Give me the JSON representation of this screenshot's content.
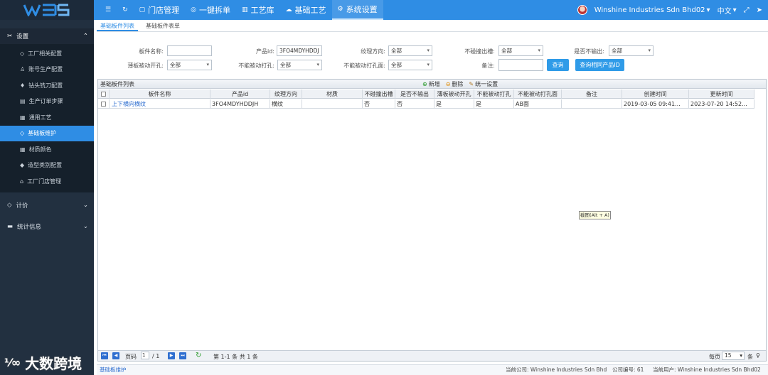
{
  "app": {
    "brand_color": "#2f8de4",
    "sidebar_color": "#223040"
  },
  "topnav": {
    "items": [
      {
        "icon": "menu-icon",
        "label": ""
      },
      {
        "icon": "refresh-icon",
        "label": ""
      },
      {
        "icon": "store-icon",
        "label": "门店管理"
      },
      {
        "icon": "check-circle-icon",
        "label": "一键拆单"
      },
      {
        "icon": "library-icon",
        "label": "工艺库"
      },
      {
        "icon": "cloud-icon",
        "label": "基础工艺"
      },
      {
        "icon": "gear-icon",
        "label": "系统设置"
      }
    ],
    "company": "Winshine Industries Sdn Bhd02",
    "language": "中文"
  },
  "sidebar": {
    "section": "设置",
    "items": [
      "工厂相关配置",
      "账号生产配置",
      "钻头铣刀配置",
      "生产订单步骤",
      "通用工艺",
      "基础板维护",
      "材质颜色",
      "造型类别配置",
      "工厂门店管理"
    ],
    "groups": [
      "计价",
      "统计信息"
    ]
  },
  "tabs": [
    "基础板件列表",
    "基础板件表单"
  ],
  "filters": {
    "board_name_label": "板件名称:",
    "board_name_value": "",
    "product_id_label": "产品id:",
    "product_id_value": "3FO4MDYHDDJ",
    "grain_label": "纹理方向:",
    "grain_value": "全部",
    "no_edge_label": "不碰撞出槽:",
    "no_edge_value": "全部",
    "no_output_label": "是否不输出:",
    "no_output_value": "全部",
    "thin_label": "薄板被动开孔:",
    "thin_value": "全部",
    "no_passive_label": "不能被动打孔:",
    "no_passive_value": "全部",
    "no_passive_face_label": "不能被动打孔面:",
    "no_passive_face_value": "全部",
    "remark_label": "备注:",
    "remark_value": "",
    "query_btn": "查询",
    "query_product_btn": "查询相同产品ID"
  },
  "grid": {
    "title": "基础板件列表",
    "tools": [
      "新增",
      "删除",
      "统一设置"
    ],
    "columns": [
      "板件名称",
      "产品id",
      "纹理方向",
      "材质",
      "不碰撞出槽",
      "是否不输出",
      "薄板被动开孔",
      "不能被动打孔",
      "不能被动打孔面",
      "备注",
      "创建时间",
      "更新时间"
    ],
    "rows": [
      [
        "上下横向横纹",
        "3FO4MDYHDDJH",
        "横纹",
        "",
        "否",
        "否",
        "是",
        "是",
        "AB面",
        "",
        "2019-03-05 09:41...",
        "2023-07-20 14:52..."
      ]
    ],
    "pager": {
      "page_label": "页码",
      "page_value": "1",
      "total_pages": "/ 1",
      "summary": "第 1-1 条  共 1 条",
      "per_page_label": "每页",
      "per_page_value": "15",
      "per_page_unit": "条"
    }
  },
  "tooltip": "截图(Alt + A)",
  "statusbar": {
    "breadcrumb": "基础板维护",
    "company": "当前公司: Winshine Industries Sdn Bhd",
    "company_no": "公司编号: 61",
    "user": "当前用户: Winshine Industries Sdn Bhd02"
  },
  "watermark": "大数跨境"
}
